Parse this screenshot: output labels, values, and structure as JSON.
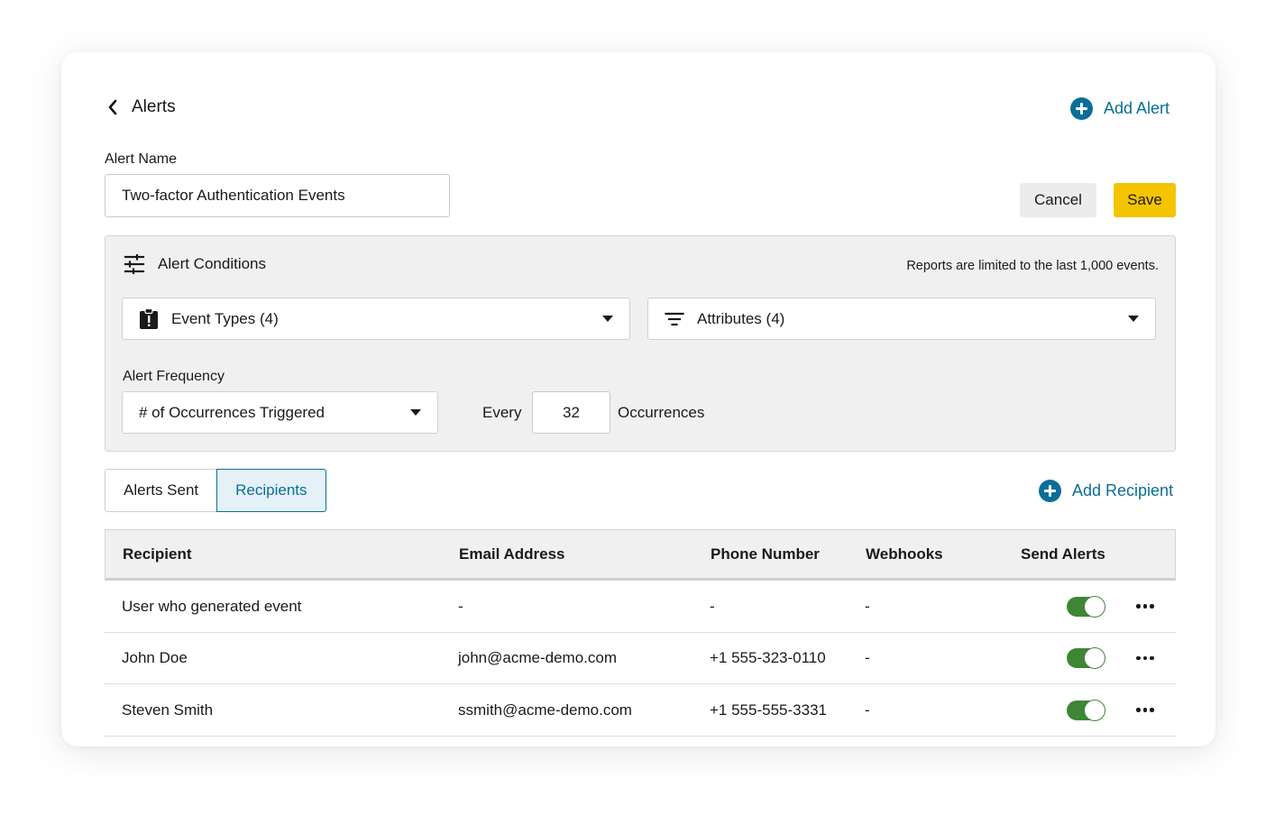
{
  "header": {
    "back_icon": "chevron-left-icon",
    "title": "Alerts",
    "add_alert_icon": "plus-circle-icon",
    "add_alert_label": "Add Alert"
  },
  "alert_name": {
    "label": "Alert Name",
    "value": "Two-factor Authentication Events"
  },
  "actions": {
    "cancel_label": "Cancel",
    "save_label": "Save",
    "save_color": "#f5c400"
  },
  "conditions": {
    "icon": "sliders-icon",
    "title": "Alert Conditions",
    "note": "Reports are limited to the last 1,000 events.",
    "event_types": {
      "icon": "clipboard-alert-icon",
      "label": "Event Types (4)"
    },
    "attributes": {
      "icon": "filter-lines-icon",
      "label": "Attributes (4)"
    },
    "frequency": {
      "label": "Alert Frequency",
      "selected": "# of Occurrences Triggered",
      "every_label": "Every",
      "count": "32",
      "unit_label": "Occurrences"
    }
  },
  "tabs": [
    {
      "label": "Alerts Sent",
      "active": false
    },
    {
      "label": "Recipients",
      "active": true
    }
  ],
  "add_recipient": {
    "icon": "plus-circle-icon",
    "label": "Add Recipient"
  },
  "table": {
    "columns": [
      "Recipient",
      "Email Address",
      "Phone Number",
      "Webhooks",
      "Send Alerts"
    ],
    "rows": [
      {
        "recipient": "User who generated event",
        "email": "-",
        "phone": "-",
        "webhooks": "-",
        "send_alerts": true
      },
      {
        "recipient": "John Doe",
        "email": "john@acme-demo.com",
        "phone": "+1 555-323-0110",
        "webhooks": "-",
        "send_alerts": true
      },
      {
        "recipient": "Steven Smith",
        "email": "ssmith@acme-demo.com",
        "phone": "+1 555-555-3331",
        "webhooks": "-",
        "send_alerts": true
      }
    ]
  },
  "colors": {
    "accent": "#0a6e98",
    "toggle_on": "#3e8635"
  }
}
